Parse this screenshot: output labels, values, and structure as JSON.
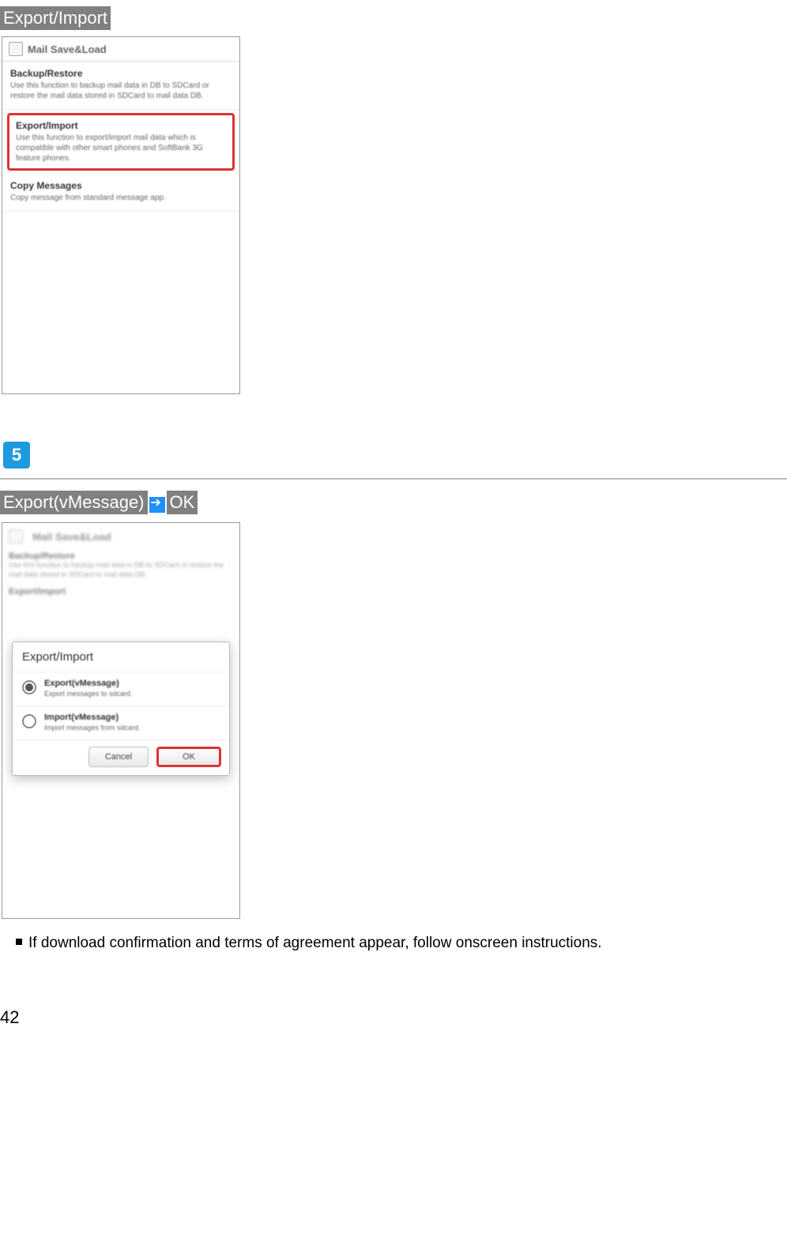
{
  "step4": {
    "label": "Export/Import",
    "screenshot": {
      "header_title": "Mail Save&Load",
      "item1": {
        "title": "Backup/Restore",
        "desc": "Use this function to backup mail data in DB to SDCard or restore the mail data stored in SDCard to mail data DB."
      },
      "item2": {
        "title": "Export/Import",
        "desc": "Use this function to export/import mail data which is compatible with other smart phones and SoftBank 3G feature phones."
      },
      "item3": {
        "title": "Copy Messages",
        "desc": "Copy message from standard message app."
      }
    }
  },
  "step5": {
    "number": "5",
    "label_a": "Export(vMessage)",
    "label_b": "OK",
    "screenshot": {
      "back_header": "Mail Save&Load",
      "back_sect1_title": "Backup/Restore",
      "back_sect1_desc": "Use this function to backup mail data in DB to SDCard or restore the mail data stored in SDCard to mail data DB.",
      "back_sect2_title": "Export/Import",
      "dialog_title": "Export/Import",
      "opt1": {
        "title": "Export(vMessage)",
        "desc": "Export messages to sdcard."
      },
      "opt2": {
        "title": "Import(vMessage)",
        "desc": "Import messages from sdcard."
      },
      "btn_cancel": "Cancel",
      "btn_ok": "OK"
    }
  },
  "note": "If download confirmation and terms of agreement appear, follow onscreen instructions.",
  "page_number": "42"
}
